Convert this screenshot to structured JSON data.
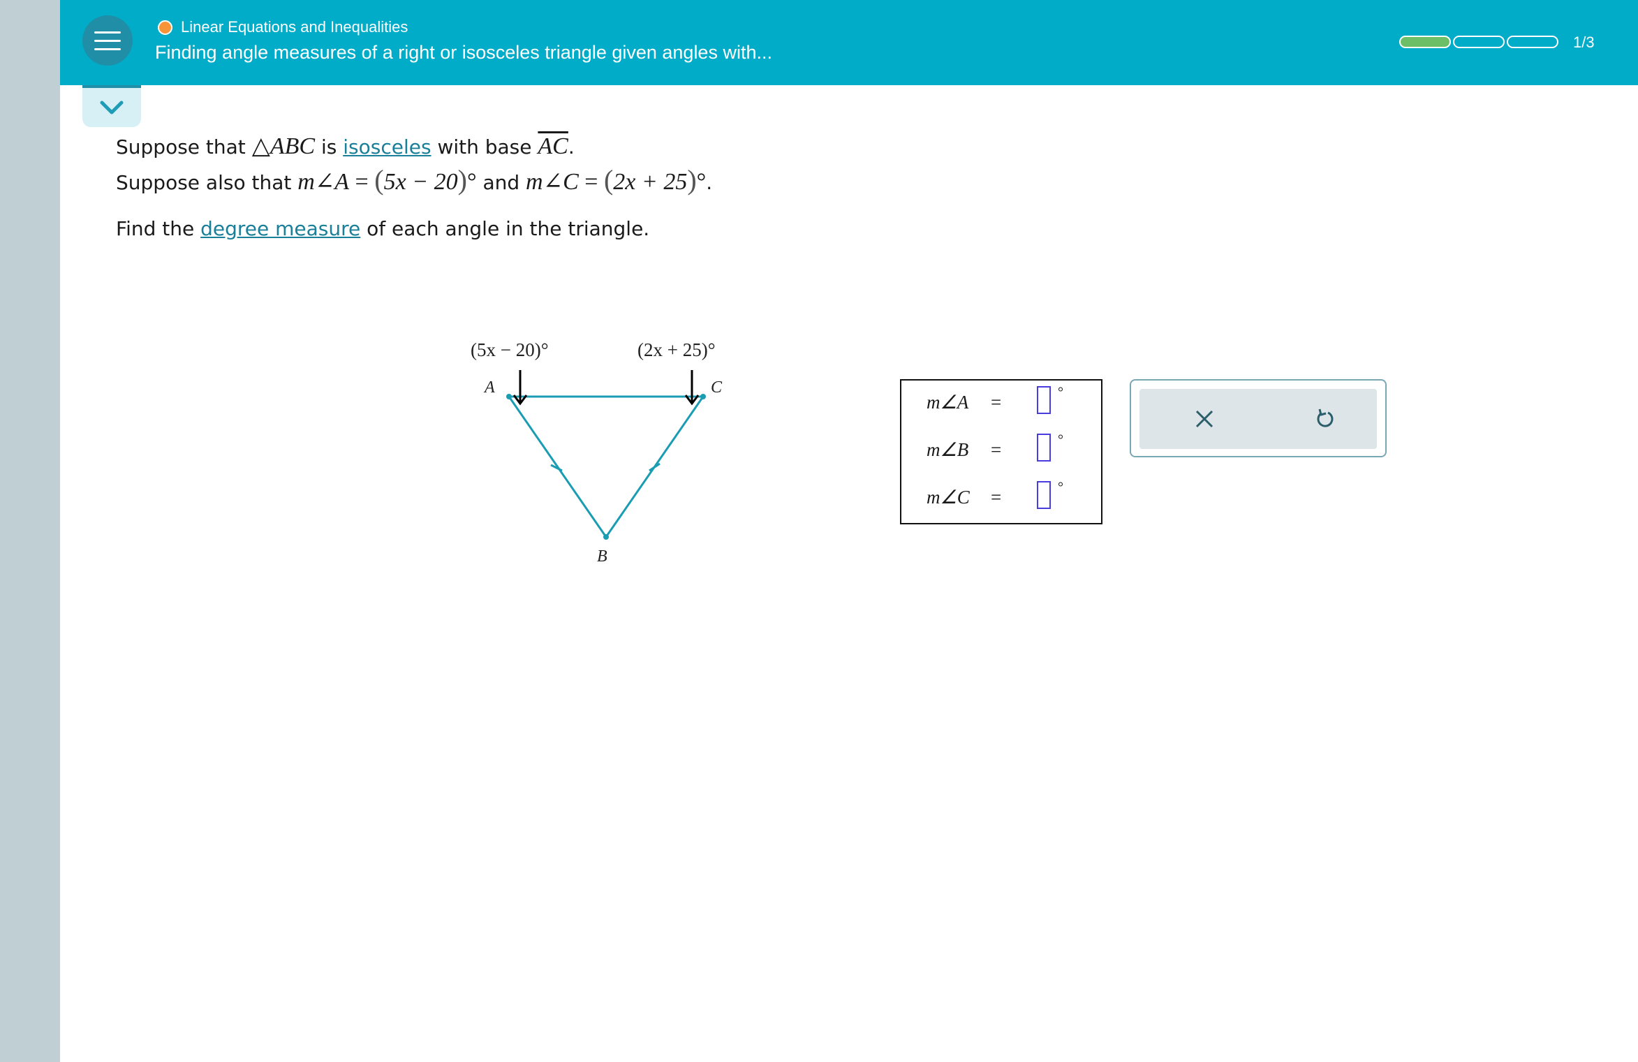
{
  "header": {
    "topic": "Linear Equations and Inequalities",
    "title": "Finding angle measures of a right or isosceles triangle given angles with...",
    "progress_filled": 1,
    "progress_total": 3,
    "progress_label": "1/3",
    "accent_color": "#00acc8",
    "topic_dot_color": "#f7943a",
    "progress_fill_color": "#6dbf67"
  },
  "problem": {
    "p1_text1": "Suppose that ",
    "p1_triangle": "△",
    "p1_abc": "ABC",
    "p1_text2": " is ",
    "p1_link": "isosceles",
    "p1_text3": " with base ",
    "p1_base": "AC",
    "p1_end": ".",
    "p2_text1": "Suppose also that ",
    "p2_mA": "m∠A",
    "p2_eq1": " = ",
    "p2_exprA": "5x − 20",
    "p2_and": " and ",
    "p2_mC": "m∠C",
    "p2_eq2": " = ",
    "p2_exprC": "2x + 25",
    "p2_degree": "°",
    "p2_end": ".",
    "p3_text1": "Find the ",
    "p3_link": "degree measure",
    "p3_text2": " of each angle in the triangle."
  },
  "diagram": {
    "label_angle_A": "(5x − 20)°",
    "label_angle_C": "(2x + 25)°",
    "vertex_A": "A",
    "vertex_B": "B",
    "vertex_C": "C",
    "triangle_color": "#1a9cb3"
  },
  "answers": {
    "rows": [
      {
        "label": "m∠A",
        "eq": "=",
        "value": "",
        "unit": "°"
      },
      {
        "label": "m∠B",
        "eq": "=",
        "value": "",
        "unit": "°"
      },
      {
        "label": "m∠C",
        "eq": "=",
        "value": "",
        "unit": "°"
      }
    ]
  },
  "actions": {
    "clear_icon": "close-icon",
    "undo_icon": "undo-icon"
  }
}
